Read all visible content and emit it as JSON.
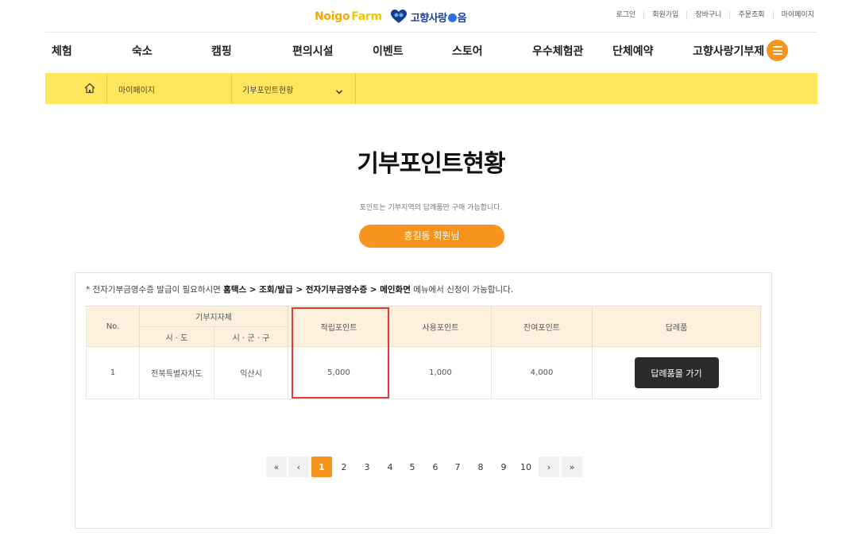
{
  "header": {
    "logo_noigo": "Noigo",
    "logo_farm": "Farm",
    "logo_hometown_left": "고향사랑",
    "logo_hometown_right": "음",
    "util_links": [
      "로그인",
      "회원가입",
      "장바구니",
      "주문조회",
      "마이페이지"
    ]
  },
  "nav": {
    "items": [
      "체험",
      "숙소",
      "캠핑",
      "편의시설",
      "이벤트",
      "스토어",
      "우수체험관",
      "단체예약",
      "고향사랑기부제"
    ],
    "menu_icon": "hamburger-icon"
  },
  "breadcrumb": {
    "home_icon": "home-icon",
    "level1": "마이페이지",
    "level2": "기부포인트현황"
  },
  "page": {
    "title": "기부포인트현황",
    "description": "포인트는 기부지역의 답례품만 구매 가능합니다.",
    "member_label": "홍길동 회원님"
  },
  "notice": {
    "prefix": "* 전자기부금영수증 발급이 필요하시면",
    "path": "홈택스 > 조회/발급 > 전자기부금영수증 > 메인화면",
    "suffix": "메뉴에서 신청이 가능합니다."
  },
  "table": {
    "headers": {
      "no": "No.",
      "donation_region": "기부지자체",
      "sido": "시 · 도",
      "sigungu": "시 · 군 · 구",
      "earned": "적립포인트",
      "used": "사용포인트",
      "remaining": "잔여포인트",
      "gift": "답례품"
    },
    "rows": [
      {
        "no": "1",
        "sido": "전북특별자치도",
        "sigungu": "익산시",
        "earned": "5,000",
        "used": "1,000",
        "remaining": "4,000",
        "button": "답례품몰 가기"
      }
    ]
  },
  "pagination": {
    "first": "«",
    "prev": "‹",
    "pages": [
      "1",
      "2",
      "3",
      "4",
      "5",
      "6",
      "7",
      "8",
      "9",
      "10"
    ],
    "current": "1",
    "next": "›",
    "last": "»"
  },
  "colors": {
    "accent_orange": "#f7941d",
    "breadcrumb_yellow": "#ffe65c",
    "table_header": "#fdf0dd",
    "highlight_red": "#e03c3c",
    "dark_button": "#2b2b2b"
  }
}
